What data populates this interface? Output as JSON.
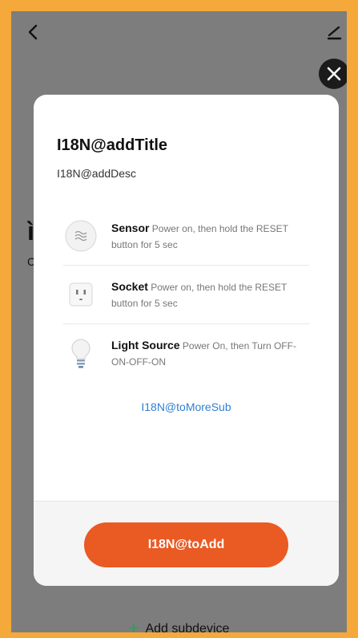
{
  "background": {
    "heading_fragment": "ì",
    "sub_fragment": "C",
    "add_subdevice_label": "Add subdevice"
  },
  "modal": {
    "title": "I18N@addTitle",
    "description": "I18N@addDesc",
    "devices": [
      {
        "name": "Sensor",
        "instruction": " Power on, then hold the RESET button for 5 sec",
        "icon": "sensor-icon"
      },
      {
        "name": "Socket",
        "instruction": " Power on, then hold the RESET button for 5 sec",
        "icon": "socket-icon"
      },
      {
        "name": "Light Source",
        "instruction": " Power On, then Turn OFF-ON-OFF-ON",
        "icon": "bulb-icon"
      }
    ],
    "more_link": "I18N@toMoreSub",
    "add_button": "I18N@toAdd"
  },
  "colors": {
    "accent": "#ea5a23",
    "link": "#2f7fd3",
    "plus": "#2aa05a",
    "frame": "#f4a93a"
  }
}
